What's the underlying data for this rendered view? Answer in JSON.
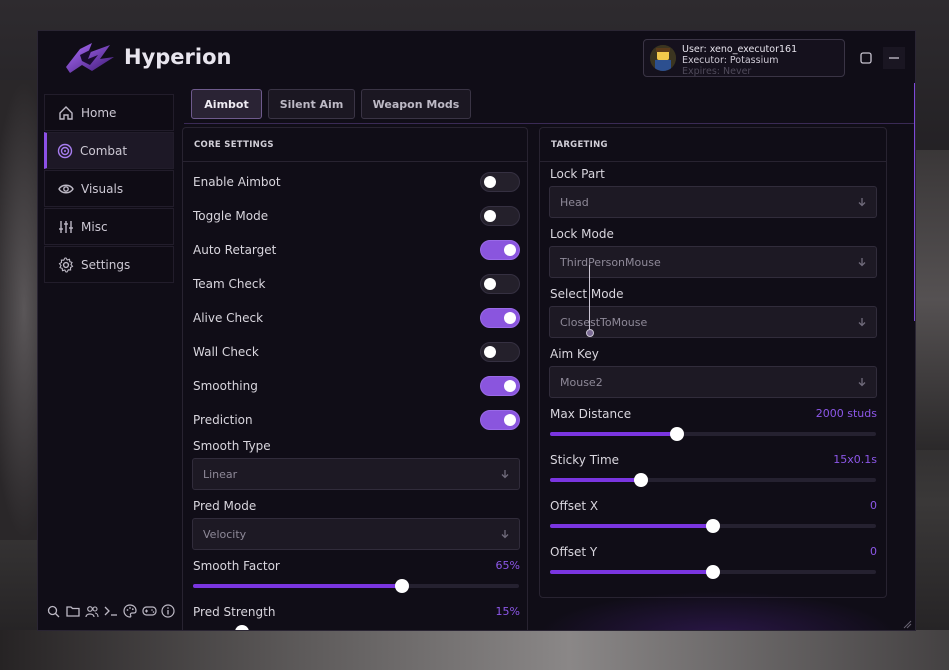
{
  "app": {
    "title": "Hyperion"
  },
  "user": {
    "line1": "User: xeno_executor161",
    "line2": "Executor: Potassium",
    "line3": "Expires: Never"
  },
  "sidebar": {
    "items": [
      {
        "label": "Home",
        "icon": "home-icon"
      },
      {
        "label": "Combat",
        "icon": "target-icon",
        "active": true
      },
      {
        "label": "Visuals",
        "icon": "eye-icon"
      },
      {
        "label": "Misc",
        "icon": "sliders-icon"
      },
      {
        "label": "Settings",
        "icon": "gear-icon"
      }
    ],
    "bottom_icons": [
      "search-icon",
      "folder-icon",
      "users-icon",
      "terminal-icon",
      "palette-icon",
      "gamepad-icon",
      "info-icon"
    ]
  },
  "tabs": [
    {
      "label": "Aimbot",
      "active": true
    },
    {
      "label": "Silent Aim"
    },
    {
      "label": "Weapon Mods"
    }
  ],
  "core": {
    "header": "CORE SETTINGS",
    "toggles": [
      {
        "label": "Enable Aimbot",
        "on": false
      },
      {
        "label": "Toggle Mode",
        "on": false
      },
      {
        "label": "Auto Retarget",
        "on": true
      },
      {
        "label": "Team Check",
        "on": false
      },
      {
        "label": "Alive Check",
        "on": true
      },
      {
        "label": "Wall Check",
        "on": false
      },
      {
        "label": "Smoothing",
        "on": true
      },
      {
        "label": "Prediction",
        "on": true
      }
    ],
    "smooth_type": {
      "label": "Smooth Type",
      "value": "Linear"
    },
    "pred_mode": {
      "label": "Pred Mode",
      "value": "Velocity"
    },
    "smooth_factor": {
      "label": "Smooth Factor",
      "value": "65%",
      "fraction": 0.64
    },
    "pred_strength": {
      "label": "Pred Strength",
      "value": "15%",
      "fraction": 0.15
    }
  },
  "targeting": {
    "header": "TARGETING",
    "lock_part": {
      "label": "Lock Part",
      "value": "Head"
    },
    "lock_mode": {
      "label": "Lock Mode",
      "value": "ThirdPersonMouse"
    },
    "select_mode": {
      "label": "Select Mode",
      "value": "ClosestToMouse"
    },
    "aim_key": {
      "label": "Aim Key",
      "value": "Mouse2"
    },
    "max_distance": {
      "label": "Max Distance",
      "value": "2000 studs",
      "fraction": 0.39
    },
    "sticky_time": {
      "label": "Sticky Time",
      "value": "15x0.1s",
      "fraction": 0.28
    },
    "offset_x": {
      "label": "Offset X",
      "value": "0",
      "fraction": 0.5
    },
    "offset_y": {
      "label": "Offset Y",
      "value": "0",
      "fraction": 0.5
    }
  },
  "colors": {
    "accent": "#8a55de",
    "slider_fill": "#7a35e0",
    "value_text": "#8c57e8",
    "window_bg": "#100d17"
  }
}
